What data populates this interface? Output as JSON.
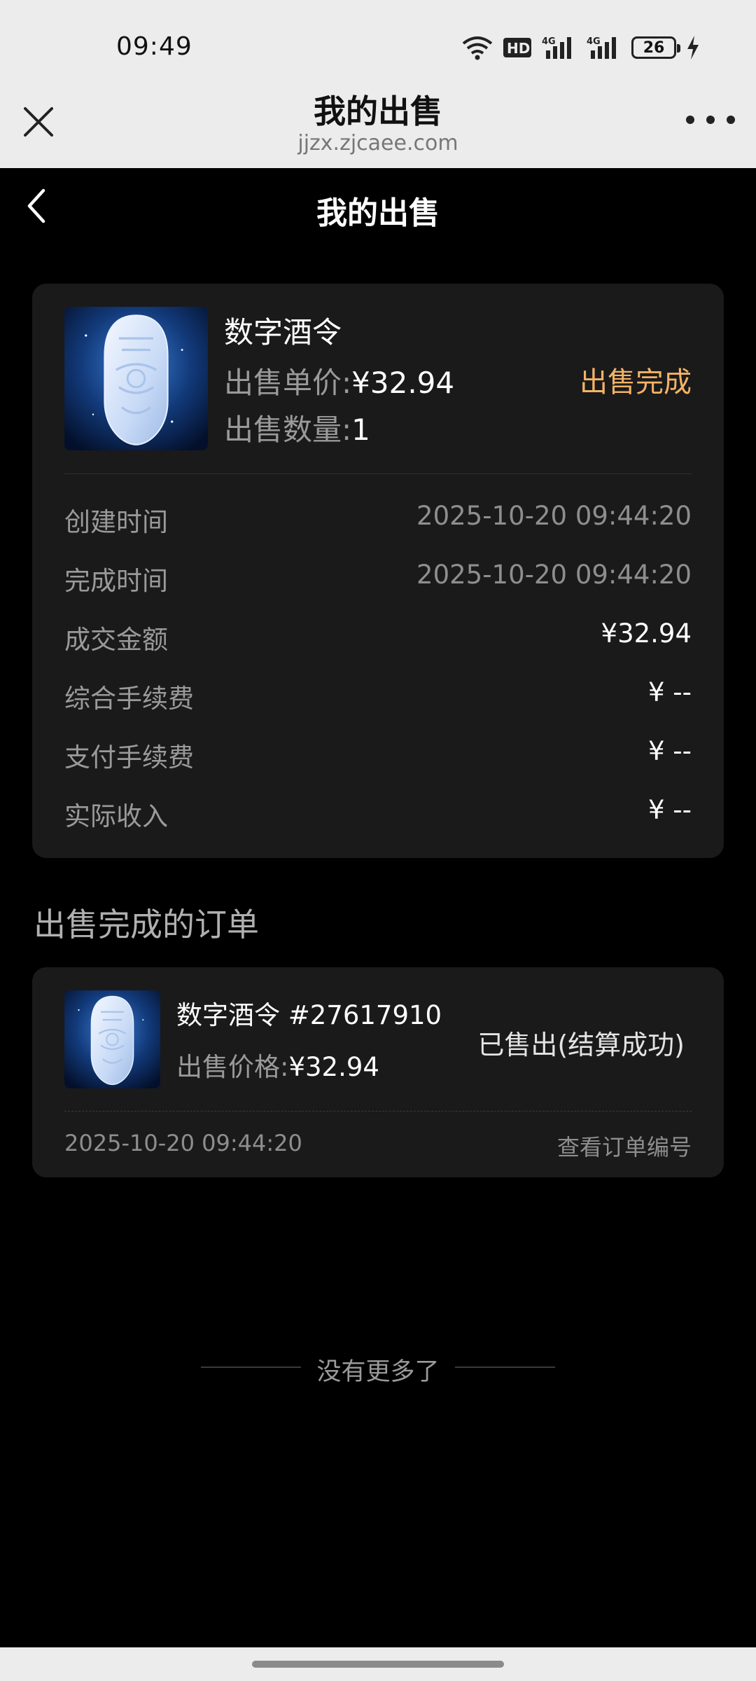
{
  "status_bar": {
    "time": "09:49",
    "battery": "26",
    "hd_badge": "HD",
    "net1": "4G",
    "net2": "4G"
  },
  "webview": {
    "title": "我的出售",
    "url": "jjzx.zjcaee.com"
  },
  "header": {
    "title": "我的出售"
  },
  "sale": {
    "name": "数字酒令",
    "price_label": "出售单价:",
    "price_value": "¥32.94",
    "qty_label": "出售数量:",
    "qty_value": "1",
    "status": "出售完成",
    "status_color": "#f3b365",
    "details": [
      {
        "label": "创建时间",
        "value": "2025-10-20 09:44:20"
      },
      {
        "label": "完成时间",
        "value": "2025-10-20 09:44:20"
      },
      {
        "label": "成交金额",
        "value": "¥32.94"
      },
      {
        "label": "综合手续费",
        "value": "¥ --"
      },
      {
        "label": "支付手续费",
        "value": "¥ --"
      },
      {
        "label": "实际收入",
        "value": "¥ --"
      }
    ]
  },
  "orders_section": {
    "title": "出售完成的订单"
  },
  "order": {
    "name": "数字酒令 #27617910",
    "price_label": "出售价格:",
    "price_value": "¥32.94",
    "status": "已售出(结算成功)",
    "date": "2025-10-20 09:44:20",
    "view_link": "查看订单编号"
  },
  "footer": {
    "no_more": "没有更多了"
  },
  "icons": {
    "close": "close-icon",
    "more": "more-icon",
    "back": "chevron-left-icon",
    "item_image": "jade-token-image"
  }
}
